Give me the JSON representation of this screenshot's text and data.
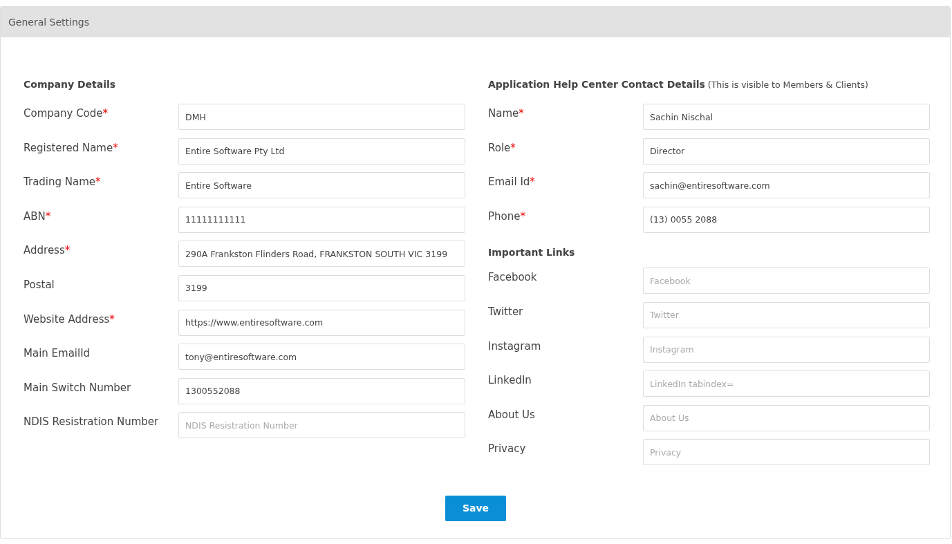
{
  "panel": {
    "title": "General Settings"
  },
  "columns": [
    {
      "heading": {
        "title": "Company Details"
      },
      "fields": [
        {
          "label": "Company Code",
          "required_mark": "*",
          "value": "DMH"
        },
        {
          "label": "Registered Name",
          "required_mark": "*",
          "value": "Entire Software Pty Ltd"
        },
        {
          "label": "Trading Name",
          "required_mark": "*",
          "value": "Entire Software"
        },
        {
          "label": "ABN",
          "required_mark": "*",
          "value": "11111111111"
        },
        {
          "label": "Address",
          "required_mark": "*",
          "value": "290A Frankston Flinders Road, FRANKSTON SOUTH VIC 3199"
        },
        {
          "label": "Postal",
          "value": "3199"
        },
        {
          "label": "Website Address",
          "required_mark": "*",
          "value": "https://www.entiresoftware.com"
        },
        {
          "label": "Main EmailId",
          "value": "tony@entiresoftware.com"
        },
        {
          "label": "Main Switch Number",
          "value": "1300552088"
        },
        {
          "label": "NDIS Resistration Number",
          "placeholder": "NDIS Resistration Number"
        }
      ]
    },
    {
      "heading": {
        "title": "Application Help Center Contact Details",
        "note": "(This is visible to Members & Clients)"
      },
      "fields": [
        {
          "label": "Name",
          "required_mark": "*",
          "value": "Sachin Nischal"
        },
        {
          "label": "Role",
          "required_mark": "*",
          "value": "Director"
        },
        {
          "label": "Email Id",
          "required_mark": "*",
          "value": "sachin@entiresoftware.com"
        },
        {
          "label": "Phone",
          "required_mark": "*",
          "value": "(13) 0055 2088"
        },
        {
          "kind": "subheading",
          "label": "Important Links"
        },
        {
          "label": "Facebook",
          "placeholder": "Facebook"
        },
        {
          "label": "Twitter",
          "placeholder": "Twitter"
        },
        {
          "label": "Instagram",
          "placeholder": "Instagram"
        },
        {
          "label": "LinkedIn",
          "placeholder": "LinkedIn tabindex="
        },
        {
          "label": "About Us",
          "placeholder": "About Us"
        },
        {
          "label": "Privacy",
          "placeholder": "Privacy"
        }
      ]
    }
  ],
  "save_button": "Save"
}
